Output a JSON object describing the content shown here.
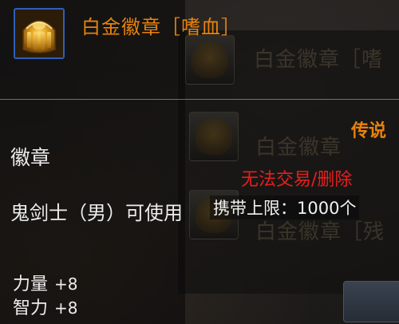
{
  "tooltip": {
    "item_name": "白金徽章［嗜血］",
    "item_type": "徽章",
    "usable_by": "鬼剑士（男）可使用",
    "stats": [
      {
        "label": "力量",
        "value": "+8"
      },
      {
        "label": "智力",
        "value": "+8"
      }
    ]
  },
  "background_panel": {
    "rarity": "传说",
    "trade_restriction": "无法交易/删除",
    "carry_limit": "携带上限：1000个",
    "faded_titles": [
      "白金徽章［嗜",
      "白金徽章",
      "白金徽章［残"
    ]
  },
  "colors": {
    "item_name": "#e8820c",
    "rarity": "#e8820c",
    "trade_restriction": "#e81e1e",
    "icon_border": "#2f5fb8"
  },
  "icons": {
    "item_icon": "gold-platinum-badge-icon"
  }
}
